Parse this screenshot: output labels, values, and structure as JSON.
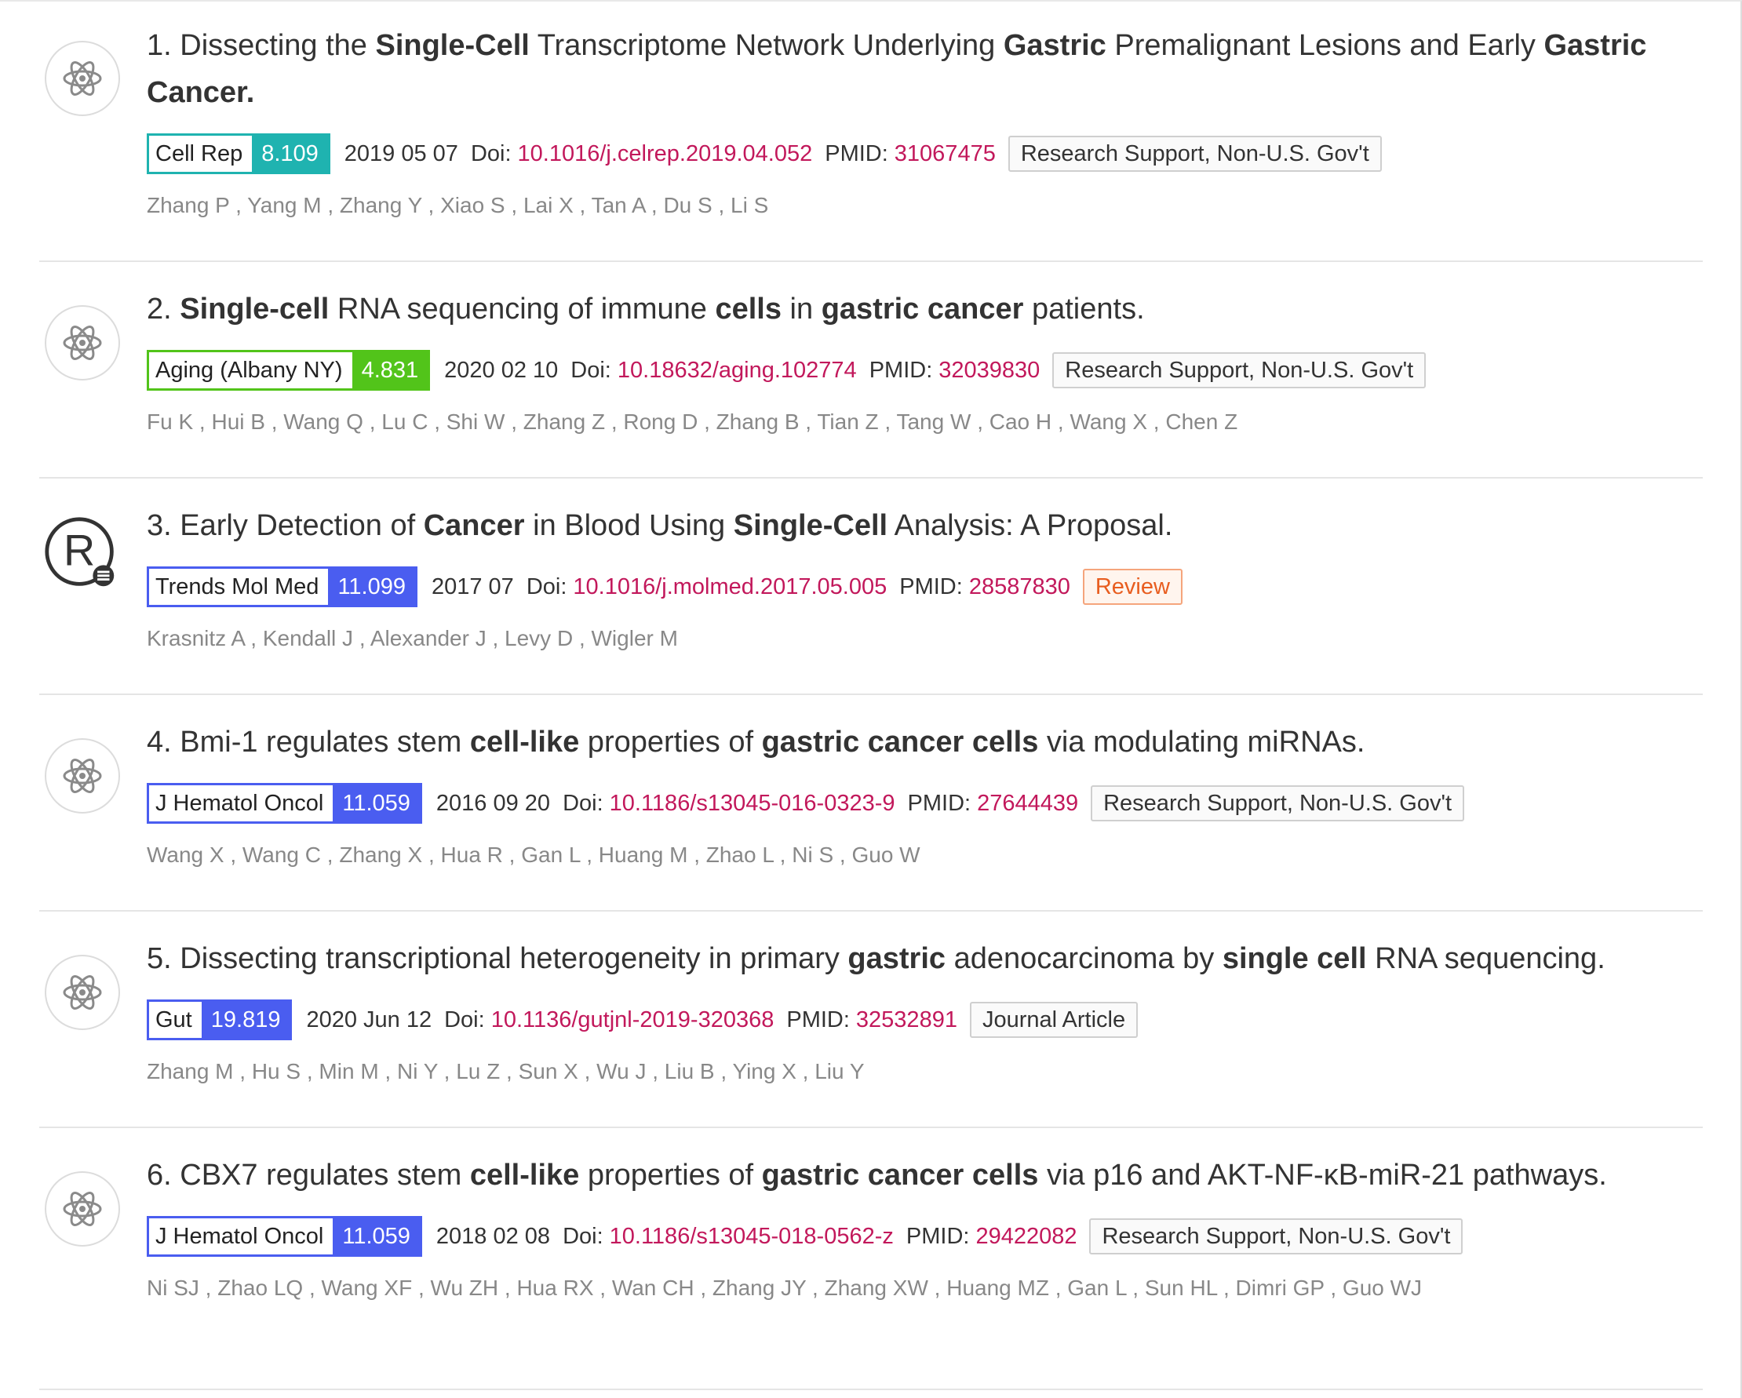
{
  "colors": {
    "link": "#c2185b",
    "teal": "#1fb3b0",
    "green": "#52c41a",
    "blue": "#4a5df0",
    "review": "#e85d1f"
  },
  "labels": {
    "doi": "Doi:",
    "pmid": "PMID:"
  },
  "articles": [
    {
      "number": "1.",
      "icon": "atom-icon",
      "title_parts": [
        {
          "t": "Dissecting the ",
          "b": false
        },
        {
          "t": "Single-Cell",
          "b": true
        },
        {
          "t": " Transcriptome Network Underlying ",
          "b": false
        },
        {
          "t": "Gastric",
          "b": true
        },
        {
          "t": " Premalignant Lesions and Early ",
          "b": false
        },
        {
          "t": "Gastric Cancer.",
          "b": true
        }
      ],
      "journal": "Cell Rep",
      "impact": "8.109",
      "journal_color": "#1fb3b0",
      "date": "2019 05 07",
      "doi": "10.1016/j.celrep.2019.04.052",
      "pmid": "31067475",
      "type": "Research Support, Non-U.S. Gov't",
      "type_style": "default",
      "authors": "Zhang P , Yang M , Zhang Y , Xiao S , Lai X , Tan A , Du S , Li S"
    },
    {
      "number": "2.",
      "icon": "atom-icon",
      "title_parts": [
        {
          "t": "Single-cell",
          "b": true
        },
        {
          "t": " RNA sequencing of immune ",
          "b": false
        },
        {
          "t": "cells",
          "b": true
        },
        {
          "t": " in ",
          "b": false
        },
        {
          "t": "gastric cancer",
          "b": true
        },
        {
          "t": " patients.",
          "b": false
        }
      ],
      "journal": "Aging (Albany NY)",
      "impact": "4.831",
      "journal_color": "#52c41a",
      "date": "2020 02 10",
      "doi": "10.18632/aging.102774",
      "pmid": "32039830",
      "type": "Research Support, Non-U.S. Gov't",
      "type_style": "default",
      "authors": "Fu K , Hui B , Wang Q , Lu C , Shi W , Zhang Z , Rong D , Zhang B , Tian Z , Tang W , Cao H , Wang X , Chen Z"
    },
    {
      "number": "3.",
      "icon": "review-icon",
      "title_parts": [
        {
          "t": "Early Detection of ",
          "b": false
        },
        {
          "t": "Cancer",
          "b": true
        },
        {
          "t": " in Blood Using ",
          "b": false
        },
        {
          "t": "Single-Cell",
          "b": true
        },
        {
          "t": " Analysis: A Proposal.",
          "b": false
        }
      ],
      "journal": "Trends Mol Med",
      "impact": "11.099",
      "journal_color": "#4a5df0",
      "date": "2017 07",
      "doi": "10.1016/j.molmed.2017.05.005",
      "pmid": "28587830",
      "type": "Review",
      "type_style": "review",
      "authors": "Krasnitz A , Kendall J , Alexander J , Levy D , Wigler M"
    },
    {
      "number": "4.",
      "icon": "atom-icon",
      "title_parts": [
        {
          "t": "Bmi-1 regulates stem ",
          "b": false
        },
        {
          "t": "cell-like",
          "b": true
        },
        {
          "t": " properties of ",
          "b": false
        },
        {
          "t": "gastric cancer cells",
          "b": true
        },
        {
          "t": " via modulating miRNAs.",
          "b": false
        }
      ],
      "journal": "J Hematol Oncol",
      "impact": "11.059",
      "journal_color": "#4a5df0",
      "date": "2016 09 20",
      "doi": "10.1186/s13045-016-0323-9",
      "pmid": "27644439",
      "type": "Research Support, Non-U.S. Gov't",
      "type_style": "default",
      "authors": "Wang X , Wang C , Zhang X , Hua R , Gan L , Huang M , Zhao L , Ni S , Guo W"
    },
    {
      "number": "5.",
      "icon": "atom-icon",
      "title_parts": [
        {
          "t": "Dissecting transcriptional heterogeneity in primary ",
          "b": false
        },
        {
          "t": "gastric",
          "b": true
        },
        {
          "t": " adenocarcinoma by ",
          "b": false
        },
        {
          "t": "single cell",
          "b": true
        },
        {
          "t": " RNA sequencing.",
          "b": false
        }
      ],
      "journal": "Gut",
      "impact": "19.819",
      "journal_color": "#4a5df0",
      "date": "2020 Jun 12",
      "doi": "10.1136/gutjnl-2019-320368",
      "pmid": "32532891",
      "type": "Journal Article",
      "type_style": "default",
      "authors": "Zhang M , Hu S , Min M , Ni Y , Lu Z , Sun X , Wu J , Liu B , Ying X , Liu Y"
    },
    {
      "number": "6.",
      "icon": "atom-icon",
      "title_parts": [
        {
          "t": "CBX7 regulates stem ",
          "b": false
        },
        {
          "t": "cell-like",
          "b": true
        },
        {
          "t": " properties of ",
          "b": false
        },
        {
          "t": "gastric cancer cells",
          "b": true
        },
        {
          "t": " via p16 and AKT-NF-κB-miR-21 pathways.",
          "b": false
        }
      ],
      "journal": "J Hematol Oncol",
      "impact": "11.059",
      "journal_color": "#4a5df0",
      "date": "2018 02 08",
      "doi": "10.1186/s13045-018-0562-z",
      "pmid": "29422082",
      "type": "Research Support, Non-U.S. Gov't",
      "type_style": "default",
      "authors": "Ni SJ , Zhao LQ , Wang XF , Wu ZH , Hua RX , Wan CH , Zhang JY , Zhang XW , Huang MZ , Gan L , Sun HL , Dimri GP , Guo WJ"
    }
  ]
}
